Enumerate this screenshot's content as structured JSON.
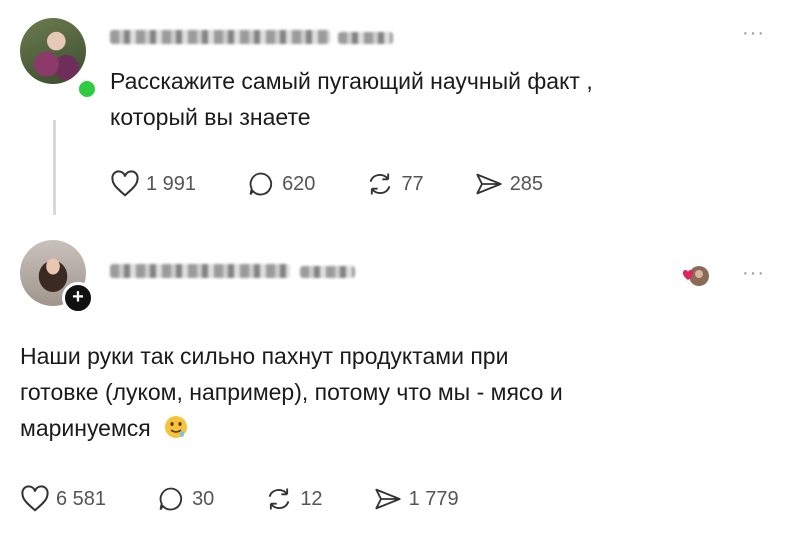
{
  "post1": {
    "text_line1": "Расскажите самый пугающий научный факт ,",
    "text_line2": "который вы знаете",
    "likes": "1 991",
    "comments": "620",
    "reposts": "77",
    "shares": "285"
  },
  "post2": {
    "text_line1": "Наши руки так сильно пахнут продуктами при",
    "text_line2": "готовке (луком, например), потому что мы - мясо и",
    "text_line3": "маринуемся",
    "likes": "6 581",
    "comments": "30",
    "reposts": "12",
    "shares": "1 779",
    "follow_symbol": "+"
  },
  "more_symbol": "···",
  "colors": {
    "online": "#2ecc40",
    "accent_heart": "#e0245e"
  }
}
